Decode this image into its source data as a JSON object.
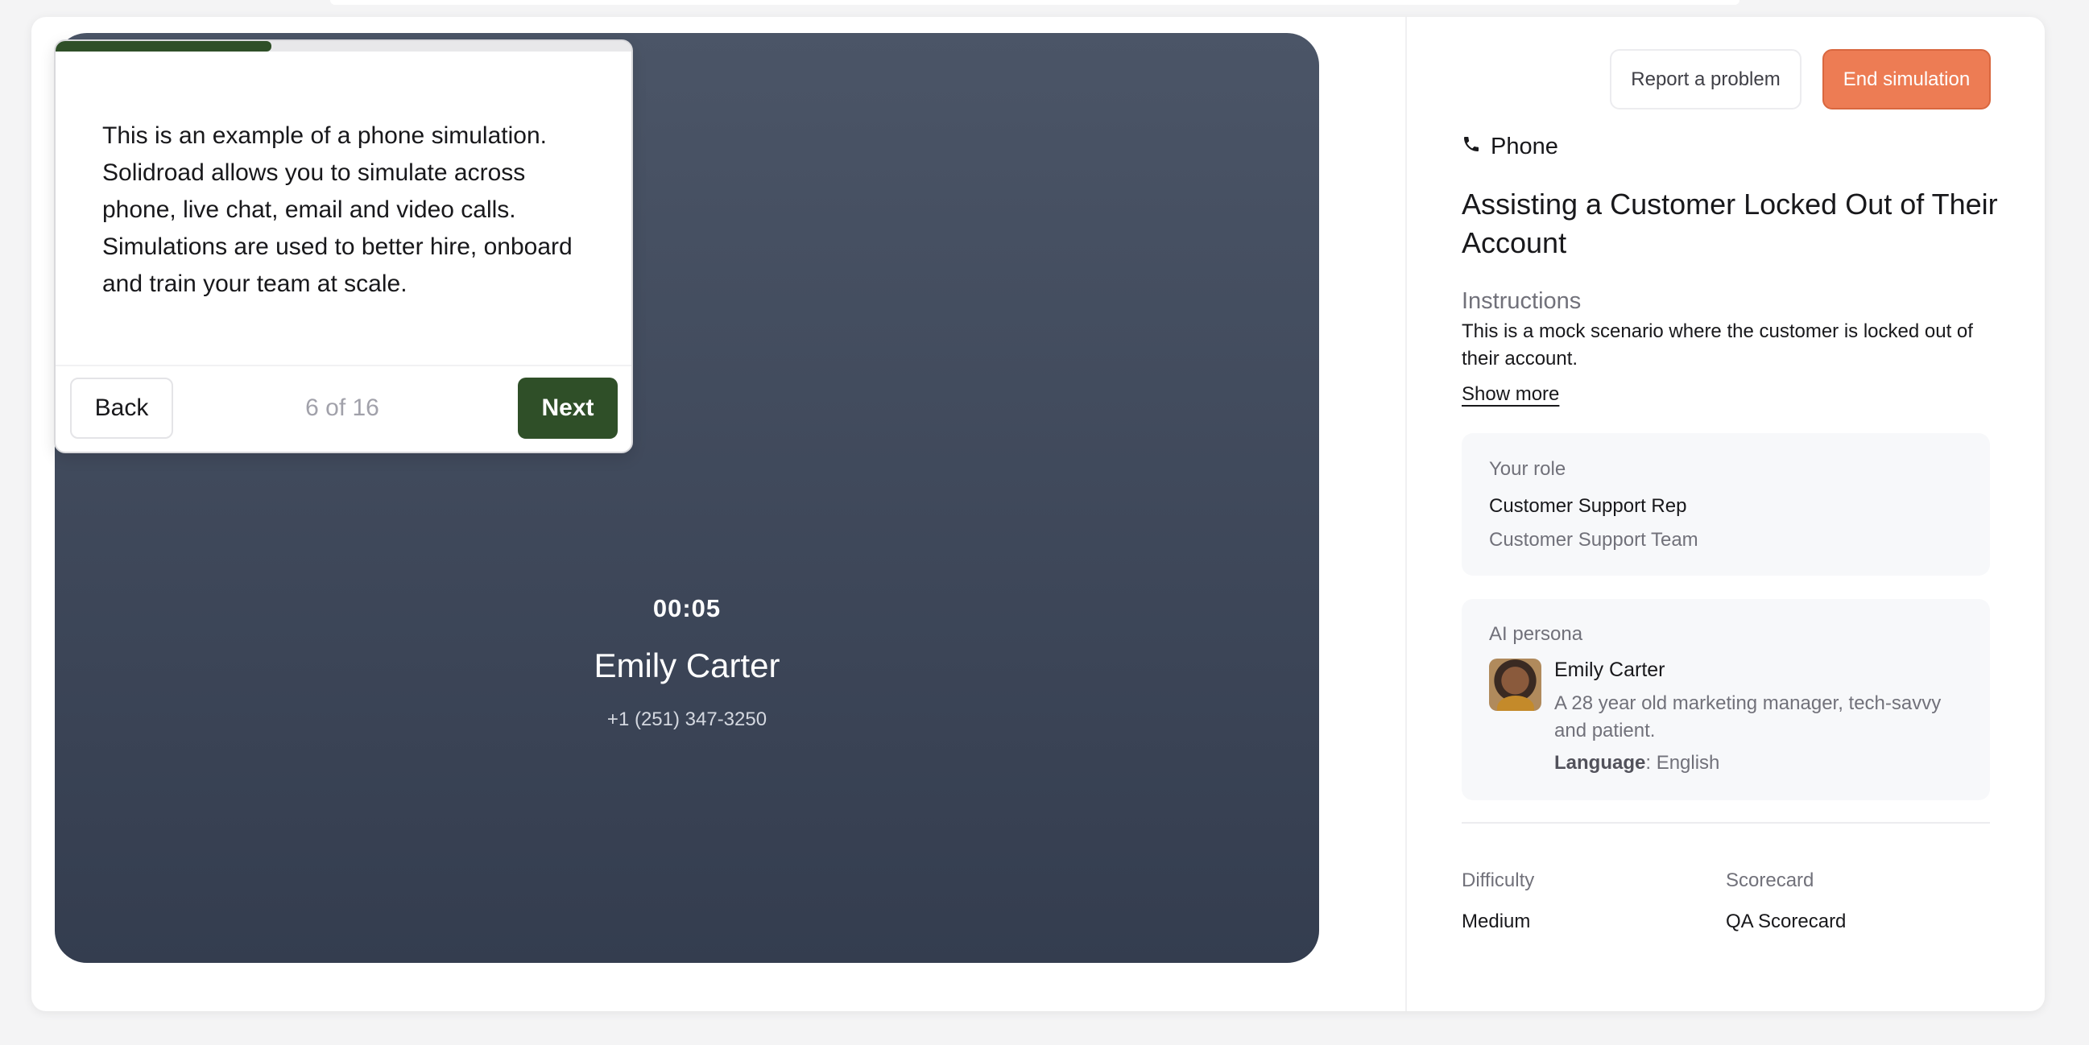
{
  "call": {
    "timer": "00:05",
    "caller_name": "Emily Carter",
    "caller_phone": "+1 (251) 347-3250"
  },
  "header": {
    "report_label": "Report a problem",
    "end_label": "End simulation",
    "colors": {
      "end_button": "#ed7c54"
    }
  },
  "scenario": {
    "channel": "Phone",
    "channel_icon": "phone-icon",
    "title": "Assisting a Customer Locked Out of Their Account",
    "instructions_label": "Instructions",
    "instructions_text": "This is a mock scenario where the customer is locked out of their account.",
    "show_more_label": "Show more"
  },
  "role": {
    "label": "Your role",
    "title": "Customer Support Rep",
    "team": "Customer Support Team"
  },
  "persona": {
    "label": "AI persona",
    "name": "Emily Carter",
    "description": "A 28 year old marketing manager, tech-savvy and patient.",
    "language_label": "Language",
    "language_value": "English"
  },
  "meta": {
    "difficulty_label": "Difficulty",
    "difficulty_value": "Medium",
    "scorecard_label": "Scorecard",
    "scorecard_value": "QA Scorecard"
  },
  "tour": {
    "text": "This is an example of a phone simulation. Solidroad allows you to simulate across phone, live chat, email and video calls. Simulations are used to better hire, onboard and train your team at scale.",
    "back_label": "Back",
    "next_label": "Next",
    "step_text": "6 of 16",
    "progress_fraction": 0.375,
    "colors": {
      "accent": "#2f4f28"
    }
  }
}
